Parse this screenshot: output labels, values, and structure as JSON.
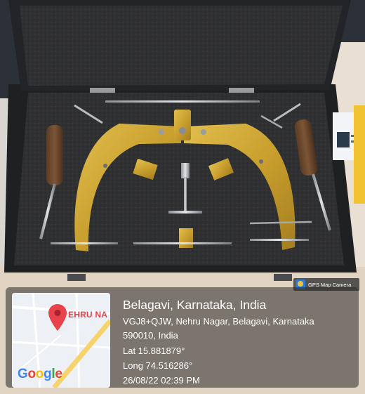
{
  "badge": {
    "label": "GPS Map Camera",
    "icon": "gps-map-camera-icon"
  },
  "map": {
    "street_label": "EHRU NA",
    "google_letters": [
      "G",
      "o",
      "o",
      "g",
      "l",
      "e"
    ],
    "pin_color": "#e8434a"
  },
  "location": {
    "title": "Belagavi, Karnataka, India",
    "address_line1": "VGJ8+QJW, Nehru Nagar, Belagavi, Karnataka",
    "address_line2": "590010, India",
    "lat": "Lat 15.881879°",
    "long": "Long 74.516286°",
    "datetime": "26/08/22 02:39 PM"
  },
  "colors": {
    "case_black": "#2a2b2d",
    "foam": "#303133",
    "brass": "#c9a33a",
    "table": "#e8dccb"
  }
}
